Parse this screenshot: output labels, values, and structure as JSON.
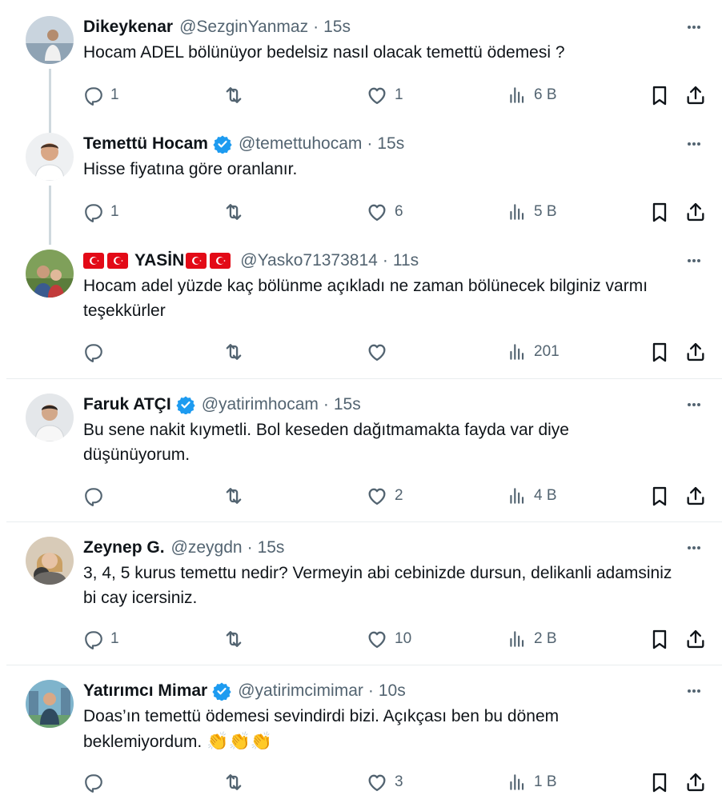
{
  "tweets": [
    {
      "name": "Dikeykenar",
      "handle": "@SezginYanmaz",
      "time": "15s",
      "text": "Hocam ADEL bölünüyor bedelsiz nasıl olacak temettü ödemesi ?",
      "replies": "1",
      "retweets": "",
      "likes": "1",
      "views": "6 B"
    },
    {
      "name": "Temettü Hocam",
      "handle": "@temettuhocam",
      "time": "15s",
      "text": "Hisse fiyatına göre oranlanır.",
      "replies": "1",
      "retweets": "",
      "likes": "6",
      "views": "5 B"
    },
    {
      "name": "YASİN",
      "handle": "@Yasko71373814",
      "time": "11s",
      "text": "Hocam adel yüzde kaç bölünme açıkladı ne zaman bölünecek bilginiz varmı teşekkürler",
      "replies": "",
      "retweets": "",
      "likes": "",
      "views": "201"
    },
    {
      "name": "Faruk ATÇI",
      "handle": "@yatirimhocam",
      "time": "15s",
      "text": "Bu sene nakit kıymetli. Bol keseden dağıtmamakta fayda var diye düşünüyorum.",
      "replies": "",
      "retweets": "",
      "likes": "2",
      "views": "4 B"
    },
    {
      "name": "Zeynep G.",
      "handle": "@zeygdn",
      "time": "15s",
      "text": "3, 4, 5 kurus temettu nedir? Vermeyin abi cebinizde dursun, delikanli adamsiniz bi cay icersiniz.",
      "replies": "1",
      "retweets": "",
      "likes": "10",
      "views": "2 B"
    },
    {
      "name": "Yatırımcı Mimar",
      "handle": "@yatirimcimimar",
      "time": "10s",
      "text": "Doas’ın temettü ödemesi sevindirdi bizi. Açıkçası ben bu dönem beklemiyordum.",
      "emoji": "👏👏👏",
      "replies": "",
      "retweets": "",
      "likes": "3",
      "views": "1 B"
    }
  ],
  "colors": {
    "text": "#0f1419",
    "secondary": "#536471",
    "verified": "#1d9bf0",
    "divider": "#e9edef",
    "thread_line": "#cfd9de",
    "flag": "#e30a17"
  },
  "icons": {
    "reply": "reply-icon",
    "retweet": "retweet-icon",
    "like": "heart-icon",
    "views": "views-chart-icon",
    "bookmark": "bookmark-icon",
    "share": "share-icon",
    "more": "more-dots-icon",
    "verified": "verified-badge-icon",
    "flag": "turkey-flag-icon"
  }
}
